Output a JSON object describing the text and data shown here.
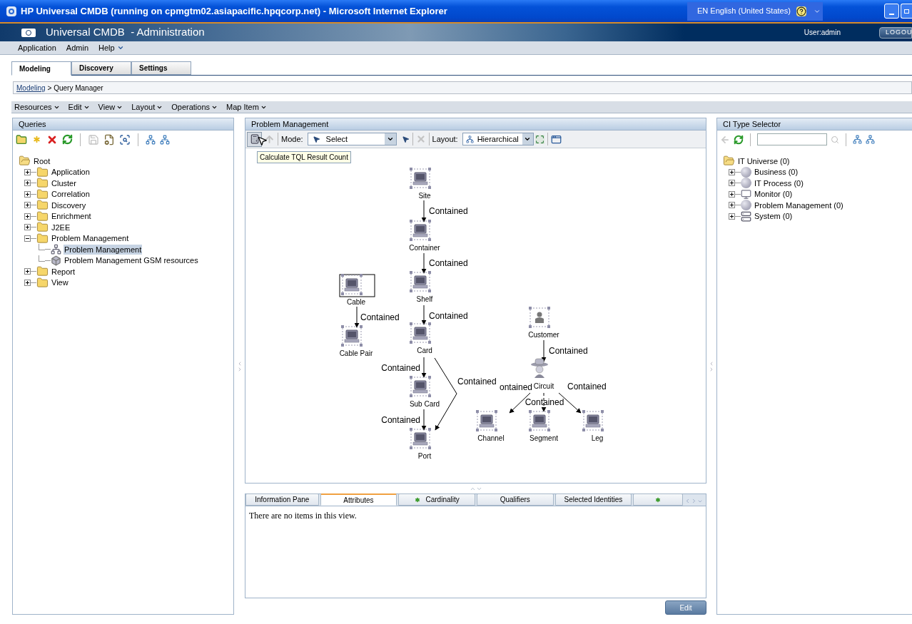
{
  "window": {
    "title": "HP Universal CMDB (running on cpmgtm02.asiapacific.hpqcorp.net) - Microsoft Internet Explorer",
    "language": "EN English (United States)"
  },
  "header": {
    "title": "Universal CMDB  - Administration",
    "user": "User:admin",
    "logout": "LOGOU"
  },
  "menu": [
    {
      "label": "Application",
      "has_dropdown": false
    },
    {
      "label": "Admin",
      "has_dropdown": false
    },
    {
      "label": "Help",
      "has_dropdown": true
    }
  ],
  "tabs": [
    {
      "label": "Modeling",
      "selected": true
    },
    {
      "label": "Discovery",
      "selected": false
    },
    {
      "label": "Settings",
      "selected": false
    }
  ],
  "breadcrumb": {
    "link": "Modeling",
    "rest": "> Query Manager"
  },
  "toolbar_menu": [
    "Resources",
    "Edit",
    "View",
    "Layout",
    "Operations",
    "Map Item"
  ],
  "queries": {
    "title": "Queries",
    "tree": [
      {
        "label": "Root",
        "kind": "folder",
        "expanded": true,
        "selected": false,
        "children": [
          {
            "label": "Application",
            "kind": "folder",
            "expanded": false,
            "selected": false
          },
          {
            "label": "Cluster",
            "kind": "folder",
            "expanded": false,
            "selected": false
          },
          {
            "label": "Correlation",
            "kind": "folder",
            "expanded": false,
            "selected": false
          },
          {
            "label": "Discovery",
            "kind": "folder",
            "expanded": false,
            "selected": false
          },
          {
            "label": "Enrichment",
            "kind": "folder",
            "expanded": false,
            "selected": false
          },
          {
            "label": "J2EE",
            "kind": "folder",
            "expanded": false,
            "selected": false
          },
          {
            "label": "Problem Management",
            "kind": "folder",
            "expanded": true,
            "selected": false,
            "children": [
              {
                "label": "Problem Management",
                "kind": "query",
                "selected": true
              },
              {
                "label": "Problem Management GSM resources",
                "kind": "resource",
                "selected": false
              }
            ]
          },
          {
            "label": "Report",
            "kind": "folder",
            "expanded": false,
            "selected": false
          },
          {
            "label": "View",
            "kind": "folder",
            "expanded": false,
            "selected": false
          }
        ]
      }
    ]
  },
  "editor": {
    "title": "Problem Management",
    "mode_label": "Mode:",
    "mode": "Select",
    "layout_label": "Layout:",
    "layout": "Hierarchical",
    "tooltip": "Calculate TQL Result Count",
    "nodes": [
      {
        "label": "Site",
        "kind": "device",
        "selected": false
      },
      {
        "label": "Container",
        "kind": "device",
        "selected": false
      },
      {
        "label": "Shelf",
        "kind": "device",
        "selected": false
      },
      {
        "label": "Card",
        "kind": "device",
        "selected": false
      },
      {
        "label": "Sub Card",
        "kind": "device",
        "selected": false
      },
      {
        "label": "Port",
        "kind": "device",
        "selected": false
      },
      {
        "label": "Cable",
        "kind": "device",
        "selected": true
      },
      {
        "label": "Cable Pair",
        "kind": "device",
        "selected": false
      },
      {
        "label": "Customer",
        "kind": "person",
        "selected": false
      },
      {
        "label": "Circuit",
        "kind": "circuit",
        "selected": false
      },
      {
        "label": "Channel",
        "kind": "device",
        "selected": false
      },
      {
        "label": "Segment",
        "kind": "device",
        "selected": false
      },
      {
        "label": "Leg",
        "kind": "device",
        "selected": false
      }
    ],
    "edges": [
      {
        "label": "Contained"
      },
      {
        "label": "Contained"
      },
      {
        "label": "Contained"
      },
      {
        "label": "Contained"
      },
      {
        "label": "Contained"
      },
      {
        "label": "Contained"
      },
      {
        "label": "Contained"
      },
      {
        "label": "Contained"
      },
      {
        "label": "ontained"
      },
      {
        "label": "Contained"
      },
      {
        "label": "Contained"
      }
    ]
  },
  "info_pane": {
    "tabs": [
      {
        "label": "Information Pane",
        "starred": false,
        "selected": false
      },
      {
        "label": "Attributes",
        "starred": false,
        "selected": true
      },
      {
        "label": "Cardinality",
        "starred": true,
        "selected": false
      },
      {
        "label": "Qualifiers",
        "starred": false,
        "selected": false
      },
      {
        "label": "Selected Identities",
        "starred": false,
        "selected": false
      },
      {
        "starred": true,
        "selected": false
      }
    ],
    "empty_text": "There are no items in this view.",
    "edit_button": "Edit"
  },
  "ci_selector": {
    "title": "CI Type Selector",
    "tree": [
      {
        "label": "IT Universe (0)",
        "kind": "folder",
        "expanded": true,
        "selected": false,
        "children": [
          {
            "label": "Business (0)",
            "kind": "sphere",
            "expanded": false,
            "selected": false
          },
          {
            "label": "IT Process (0)",
            "kind": "sphere",
            "expanded": false,
            "selected": false
          },
          {
            "label": "Monitor (0)",
            "kind": "monitor",
            "expanded": false,
            "selected": false
          },
          {
            "label": "Problem  Management (0)",
            "kind": "sphere",
            "expanded": false,
            "selected": false
          },
          {
            "label": "System (0)",
            "kind": "system",
            "expanded": false,
            "selected": false
          }
        ]
      }
    ]
  }
}
